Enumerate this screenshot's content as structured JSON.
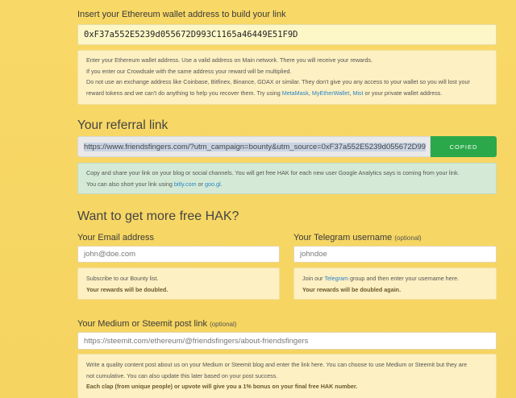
{
  "wallet": {
    "label": "Insert your Ethereum wallet address to build your link",
    "value": "0xF37a552E5239d055672D993C1165a46449E51F9D",
    "note_line1": "Enter your Ethereum wallet address. Use a valid address on Main network. There you will receive your rewards.",
    "note_line2": "If you enter our Crowdsale with the same address your reward will be multiplied.",
    "note_line3": "Do not use an exchange address like Coinbase, Bitfinex, Binance, GDAX or similar. They don't give you any access to your wallet so you will lost your",
    "note_line4_prefix": "reward tokens and we can't do anything to help you recover them. Try using",
    "link_metamask": "MetaMask",
    "sep1": ",",
    "link_myetherwallet": "MyEtherWallet",
    "sep2": ",",
    "link_mist": "Mist",
    "note_line4_suffix": "or your private wallet address."
  },
  "referral": {
    "title": "Your referral link",
    "value": "https://www.friendsfingers.com/?utm_campaign=bounty&utm_source=0xF37a552E5239d055672D99",
    "copy_button": "COPIED",
    "note_line1": "Copy and share your link on your blog or social channels. You will get free HAK for each new user Google Analytics says is coming from your link.",
    "note_line2_prefix": "You can also short your link using",
    "link_bitly": "bitly.com",
    "or": "or",
    "link_googl": "goo.gl",
    "period": "."
  },
  "more": {
    "title": "Want to get more free HAK?"
  },
  "email": {
    "label": "Your Email address",
    "placeholder": "john@doe.com",
    "note_line1": "Subscribe to our Bounty list.",
    "note_line2": "Your rewards will be doubled."
  },
  "telegram": {
    "label": "Your Telegram username",
    "optional": "(optional)",
    "placeholder": "johndoe",
    "note_prefix": "Join our",
    "link_telegram": "Telegram",
    "note_suffix": "group and then enter your username here.",
    "note_line2": "Your rewards will be doubled again."
  },
  "post": {
    "label": "Your Medium or Steemit post link",
    "optional": "(optional)",
    "placeholder": "https://steemit.com/ethereum/@friendsfingers/about-friendsfingers",
    "note_line1": "Write a quality content post about us on your Medium or Steemit blog and enter the link here. You can choose to use Medium or Steemit but they are",
    "note_line2": "not cumulative. You can also update this later based on your post success.",
    "note_line3": "Each clap (from unique people) or upvote will give you a 1% bonus on your final free HAK number."
  }
}
